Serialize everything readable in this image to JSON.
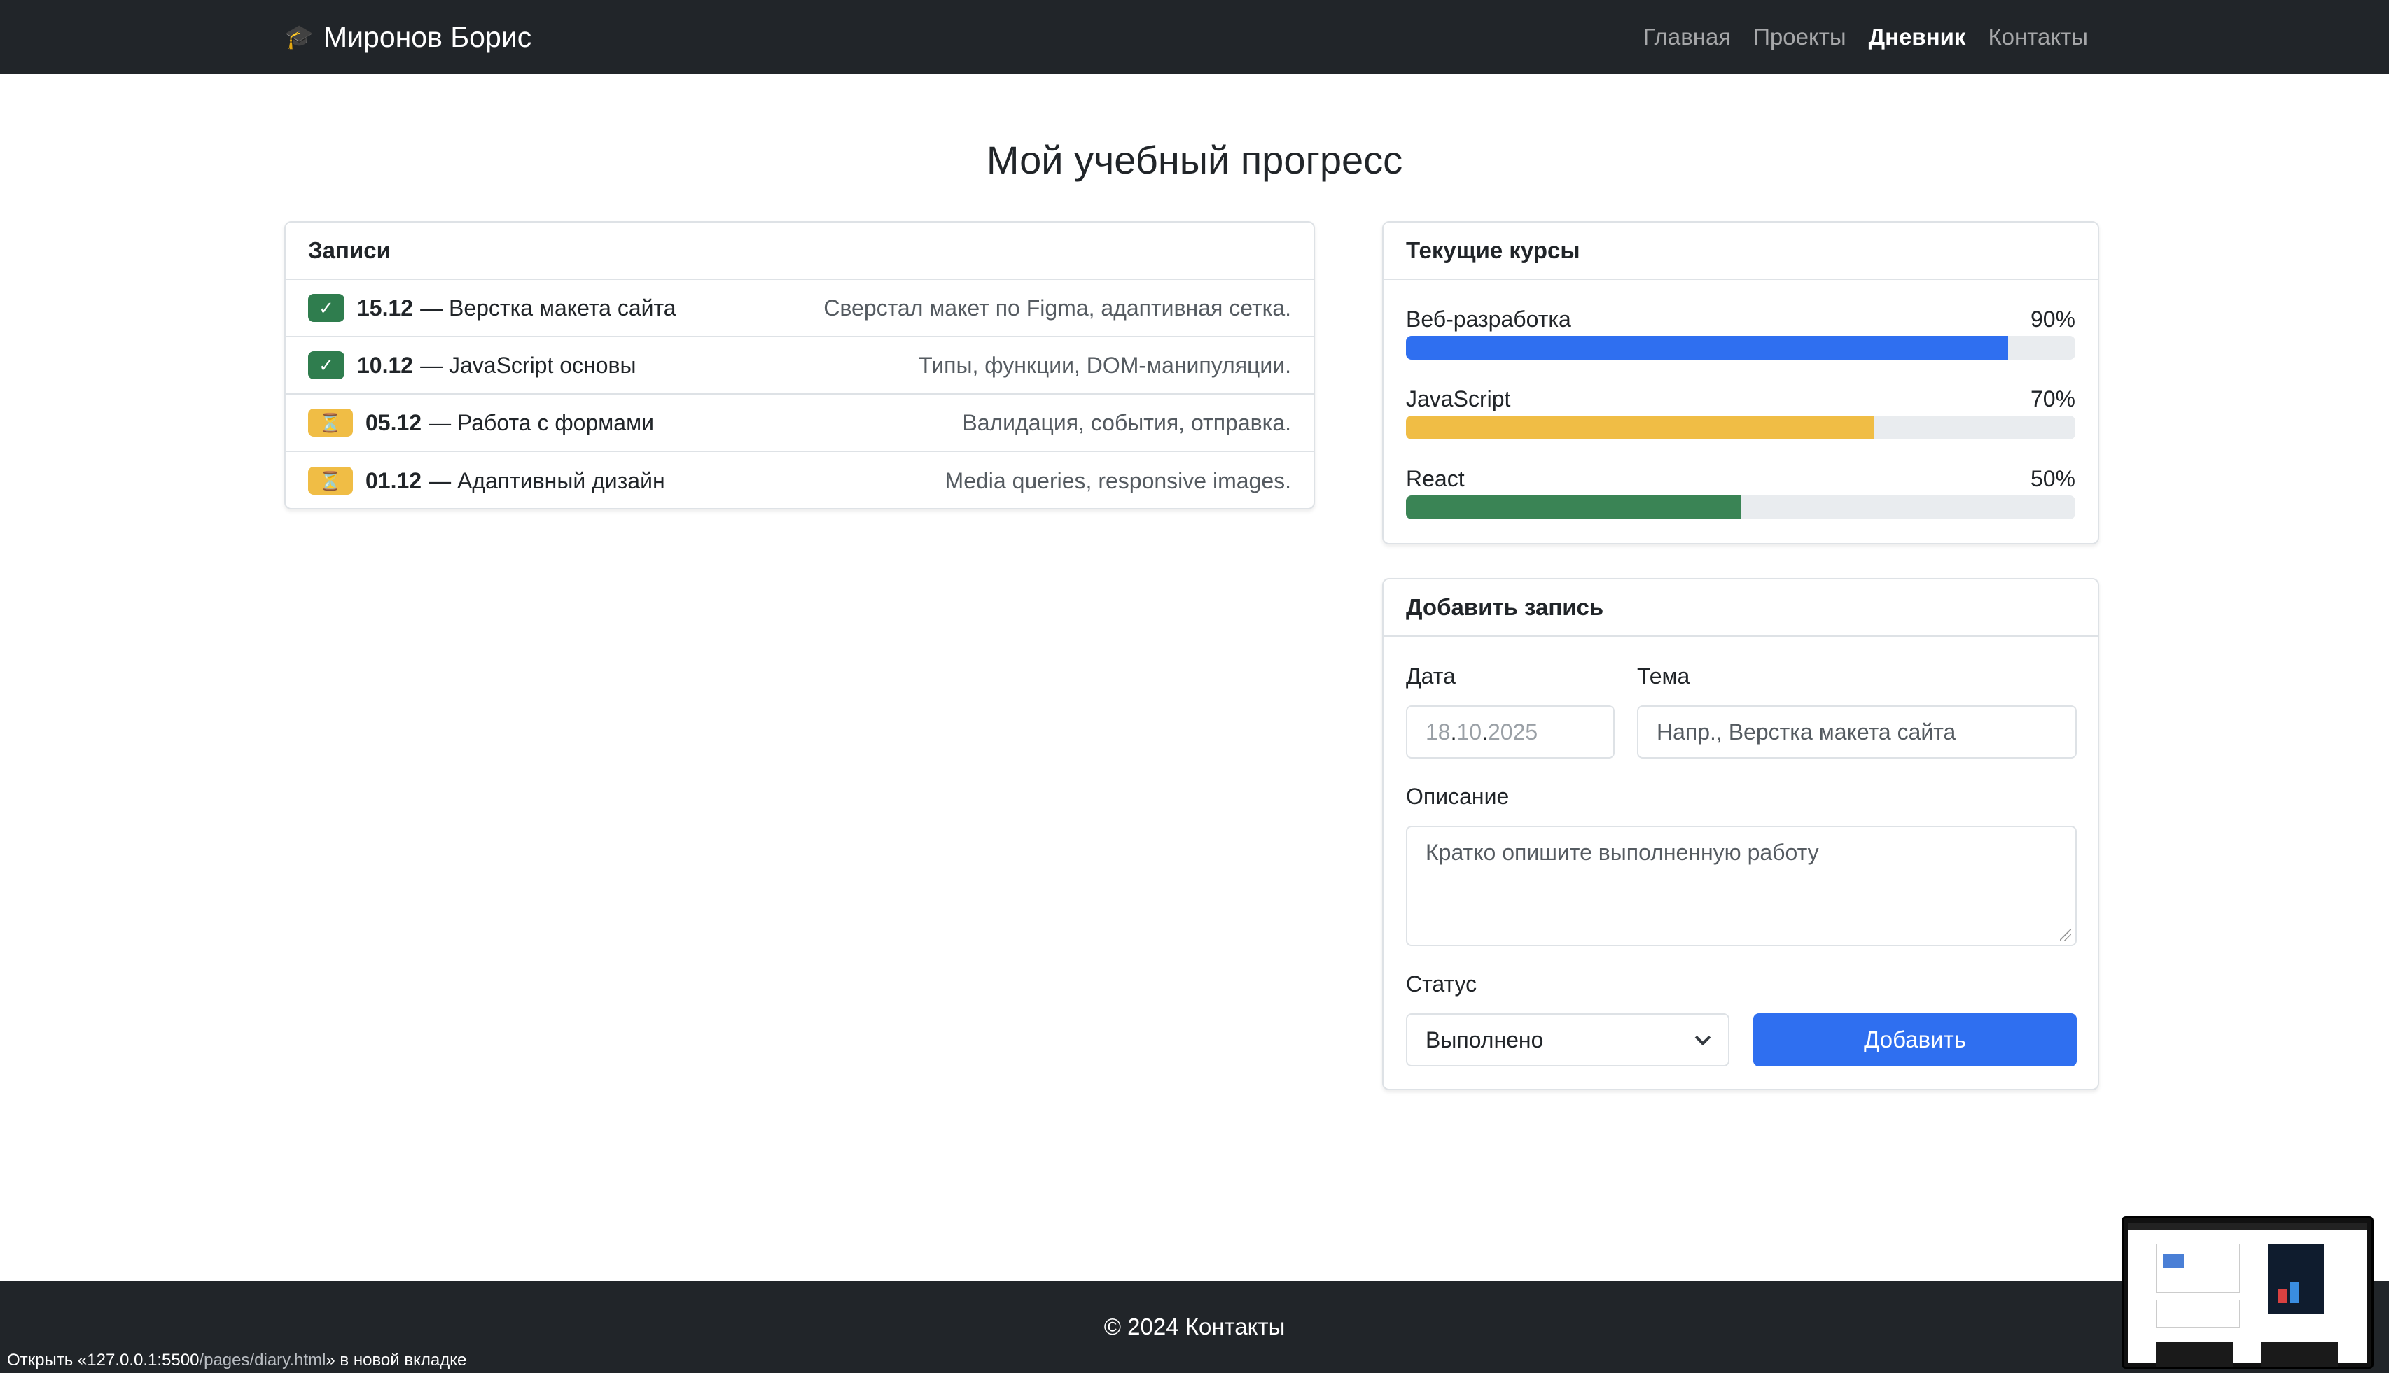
{
  "navbar": {
    "brand_icon": "graduation-cap-icon",
    "brand": "Миронов Борис",
    "links": [
      {
        "label": "Главная",
        "active": false
      },
      {
        "label": "Проекты",
        "active": false
      },
      {
        "label": "Дневник",
        "active": true
      },
      {
        "label": "Контакты",
        "active": false
      }
    ]
  },
  "page_title": "Мой учебный прогресс",
  "entries": {
    "header": "Записи",
    "items": [
      {
        "status": "done",
        "badge": "✓",
        "date": "15.12",
        "title": "— Верстка макета сайта",
        "desc": "Сверстал макет по Figma, адаптивная сетка."
      },
      {
        "status": "done",
        "badge": "✓",
        "date": "10.12",
        "title": "— JavaScript основы",
        "desc": "Типы, функции, DOM-манипуляции."
      },
      {
        "status": "pending",
        "badge": "⏳",
        "date": "05.12",
        "title": "— Работа с формами",
        "desc": "Валидация, события, отправка."
      },
      {
        "status": "pending",
        "badge": "⏳",
        "date": "01.12",
        "title": "— Адаптивный дизайн",
        "desc": "Media queries, responsive images."
      }
    ]
  },
  "courses": {
    "header": "Текущие курсы",
    "items": [
      {
        "name": "Веб-разработка",
        "percent_label": "90%",
        "progress": 0.9,
        "color": "#2f6ff0"
      },
      {
        "name": "JavaScript",
        "percent_label": "70%",
        "progress": 0.7,
        "color": "#f0bd45"
      },
      {
        "name": "React",
        "percent_label": "50%",
        "progress": 0.5,
        "color": "#3a8455"
      }
    ]
  },
  "add_form": {
    "header": "Добавить запись",
    "date_label": "Дата",
    "date_placeholder": "18.10.2025",
    "topic_label": "Тема",
    "topic_placeholder": "Напр., Верстка макета сайта",
    "desc_label": "Описание",
    "desc_placeholder": "Кратко опишите выполненную работу",
    "status_label": "Статус",
    "status_value": "Выполнено",
    "submit_label": "Добавить"
  },
  "footer": {
    "text": "© 2024 Контакты"
  },
  "status_bar": {
    "prefix": "Открыть «127.0.0.1:5500",
    "path": "/pages/diary.html",
    "suffix": "» в новой вкладке"
  },
  "colors": {
    "navbar_bg": "#212529",
    "primary": "#2f6ff0",
    "success": "#2f7d4e",
    "warning": "#f0bd45"
  }
}
